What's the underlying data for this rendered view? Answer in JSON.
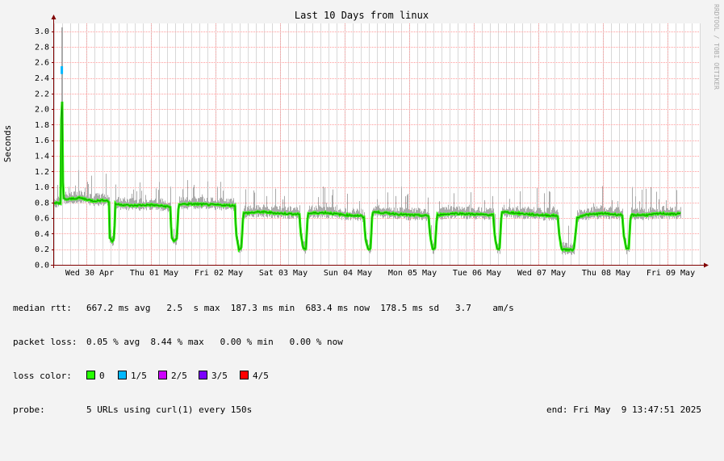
{
  "chart_data": {
    "type": "line",
    "title": "Last 10 Days from linux",
    "ylabel": "Seconds",
    "side_label": "RRDTOOL / TOBI OETIKER",
    "ylim": [
      0,
      3.1
    ],
    "yticks": [
      "0.0",
      "0.2",
      "0.4",
      "0.6",
      "0.8",
      "1.0",
      "1.2",
      "1.4",
      "1.6",
      "1.8",
      "2.0",
      "2.2",
      "2.4",
      "2.6",
      "2.8",
      "3.0"
    ],
    "xlim_days": [
      0,
      10
    ],
    "xticks": [
      {
        "label": "Wed 30 Apr",
        "day": 0.55
      },
      {
        "label": "Thu 01 May",
        "day": 1.55
      },
      {
        "label": "Fri 02 May",
        "day": 2.55
      },
      {
        "label": "Sat 03 May",
        "day": 3.55
      },
      {
        "label": "Sun 04 May",
        "day": 4.55
      },
      {
        "label": "Mon 05 May",
        "day": 5.55
      },
      {
        "label": "Tue 06 May",
        "day": 6.55
      },
      {
        "label": "Wed 07 May",
        "day": 7.55
      },
      {
        "label": "Thu 08 May",
        "day": 8.55
      },
      {
        "label": "Fri 09 May",
        "day": 9.55
      }
    ],
    "median_series": [
      [
        0.0,
        0.78
      ],
      [
        0.05,
        0.8
      ],
      [
        0.1,
        0.79
      ],
      [
        0.12,
        2.5
      ],
      [
        0.14,
        0.85
      ],
      [
        0.2,
        0.84
      ],
      [
        0.4,
        0.86
      ],
      [
        0.6,
        0.82
      ],
      [
        0.8,
        0.83
      ],
      [
        0.85,
        0.81
      ],
      [
        0.86,
        0.35
      ],
      [
        0.9,
        0.3
      ],
      [
        0.93,
        0.34
      ],
      [
        0.95,
        0.78
      ],
      [
        1.2,
        0.76
      ],
      [
        1.5,
        0.77
      ],
      [
        1.75,
        0.75
      ],
      [
        1.8,
        0.74
      ],
      [
        1.82,
        0.35
      ],
      [
        1.86,
        0.3
      ],
      [
        1.9,
        0.33
      ],
      [
        1.93,
        0.78
      ],
      [
        2.2,
        0.78
      ],
      [
        2.5,
        0.77
      ],
      [
        2.8,
        0.76
      ],
      [
        2.82,
        0.4
      ],
      [
        2.86,
        0.2
      ],
      [
        2.9,
        0.22
      ],
      [
        2.93,
        0.66
      ],
      [
        3.2,
        0.68
      ],
      [
        3.5,
        0.66
      ],
      [
        3.8,
        0.65
      ],
      [
        3.82,
        0.4
      ],
      [
        3.86,
        0.2
      ],
      [
        3.9,
        0.21
      ],
      [
        3.93,
        0.66
      ],
      [
        4.2,
        0.67
      ],
      [
        4.5,
        0.64
      ],
      [
        4.75,
        0.63
      ],
      [
        4.8,
        0.6
      ],
      [
        4.82,
        0.35
      ],
      [
        4.86,
        0.2
      ],
      [
        4.9,
        0.21
      ],
      [
        4.93,
        0.68
      ],
      [
        5.2,
        0.66
      ],
      [
        5.5,
        0.64
      ],
      [
        5.8,
        0.63
      ],
      [
        5.82,
        0.4
      ],
      [
        5.86,
        0.2
      ],
      [
        5.9,
        0.21
      ],
      [
        5.93,
        0.64
      ],
      [
        6.2,
        0.66
      ],
      [
        6.5,
        0.65
      ],
      [
        6.8,
        0.64
      ],
      [
        6.82,
        0.4
      ],
      [
        6.86,
        0.2
      ],
      [
        6.9,
        0.21
      ],
      [
        6.93,
        0.68
      ],
      [
        7.2,
        0.66
      ],
      [
        7.5,
        0.64
      ],
      [
        7.8,
        0.63
      ],
      [
        7.82,
        0.4
      ],
      [
        7.86,
        0.2
      ],
      [
        8.0,
        0.19
      ],
      [
        8.05,
        0.2
      ],
      [
        8.1,
        0.6
      ],
      [
        8.2,
        0.64
      ],
      [
        8.5,
        0.66
      ],
      [
        8.8,
        0.64
      ],
      [
        8.82,
        0.4
      ],
      [
        8.86,
        0.2
      ],
      [
        8.9,
        0.21
      ],
      [
        8.93,
        0.64
      ],
      [
        9.2,
        0.64
      ],
      [
        9.4,
        0.66
      ],
      [
        9.6,
        0.65
      ],
      [
        9.7,
        0.66
      ]
    ],
    "spike_day": 0.12,
    "colors": {
      "loss_0": "#26ff00",
      "loss_1_5": "#00b8ff",
      "loss_2_5": "#cc00ff",
      "loss_3_5": "#7b00ff",
      "loss_4_5": "#ff0000",
      "smoke": "#aaaaaa",
      "grid_major": "#ff9b9b",
      "grid_minor": "#d8d8d8",
      "axis_arrow": "#800000",
      "background": "#f3f3f3",
      "plot_background": "#ffffff"
    }
  },
  "legend": {
    "median_label": "median rtt:",
    "median_values": "667.2 ms avg   2.5  s max  187.3 ms min  683.4 ms now  178.5 ms sd   3.7    am/s",
    "loss_label": "packet loss:",
    "loss_values": "0.05 % avg  8.44 % max   0.00 % min   0.00 % now",
    "color_label": "loss color:",
    "loss_colors": [
      {
        "label": "0",
        "color": "#26ff00"
      },
      {
        "label": "1/5",
        "color": "#00b8ff"
      },
      {
        "label": "2/5",
        "color": "#cc00ff"
      },
      {
        "label": "3/5",
        "color": "#7b00ff"
      },
      {
        "label": "4/5",
        "color": "#ff0000"
      }
    ],
    "probe_label": "probe:",
    "probe_value": "5 URLs using curl(1) every 150s",
    "end_label": "end: Fri May  9 13:47:51 2025"
  }
}
